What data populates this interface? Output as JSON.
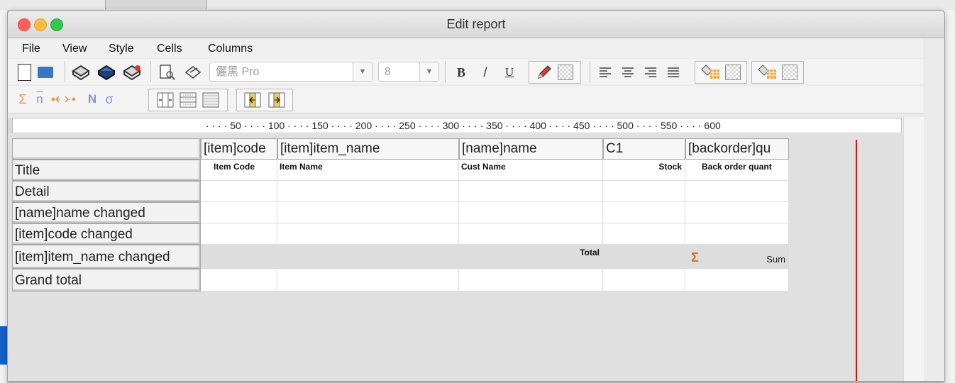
{
  "window": {
    "title": "Edit report"
  },
  "menu": [
    "File",
    "View",
    "Style",
    "Cells",
    "Columns"
  ],
  "toolbar": {
    "font_name": "儷黑 Pro",
    "font_size": "8",
    "bold": "B",
    "italic": "/",
    "underline": "U",
    "row2_symbols": [
      "Σ",
      "n",
      "N",
      "σ"
    ]
  },
  "ruler": {
    "labels": "· · · · 50 · · · · 100 · · · · 150 · · · · 200 · · · · 250 · · · · 300 · · · · 350 · · · · 400 · · · · 450 · · · · 500 · · · · 550 · · · · 600"
  },
  "bands": [
    "Title",
    "Detail",
    "[name]name changed",
    "[item]code changed",
    "[item]item_name changed",
    "Grand total"
  ],
  "columns": [
    "[item]code",
    "[item]item_name",
    "[name]name",
    "C1",
    "[backorder]qu"
  ],
  "title_row": [
    "Item Code",
    "Item Name",
    "Cust Name",
    "Stock",
    "Back order quant"
  ],
  "group_row": {
    "total_label": "Total",
    "sum_symbol": "Σ",
    "sum_label": "Sum"
  }
}
